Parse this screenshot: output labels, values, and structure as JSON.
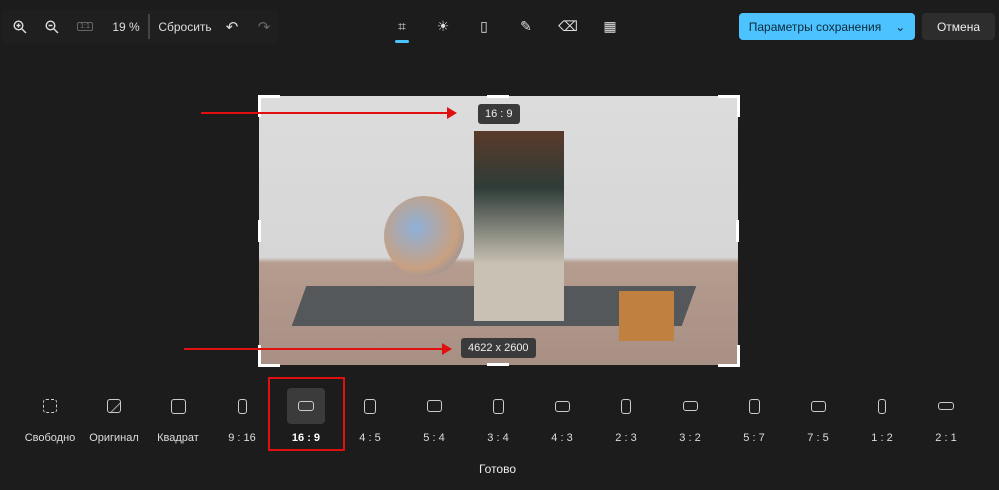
{
  "toolbar": {
    "zoom": "19 %",
    "reset": "Сбросить",
    "one_to_one": "1:1"
  },
  "tools": [
    "crop",
    "brightness",
    "marker",
    "pen",
    "eraser",
    "background-blur"
  ],
  "save_label": "Параметры сохранения",
  "cancel_label": "Отмена",
  "canvas": {
    "ratio_tag": "16 : 9",
    "size_tag": "4622 x 2600"
  },
  "ratios": [
    {
      "label": "Свободно",
      "shape": "free",
      "w": 14,
      "h": 14
    },
    {
      "label": "Оригинал",
      "shape": "image",
      "w": 14,
      "h": 14
    },
    {
      "label": "Квадрат",
      "shape": "rect",
      "w": 15,
      "h": 15
    },
    {
      "label": "9 : 16",
      "shape": "rect",
      "w": 9,
      "h": 15
    },
    {
      "label": "16 : 9",
      "shape": "rect",
      "w": 16,
      "h": 10
    },
    {
      "label": "4 : 5",
      "shape": "rect",
      "w": 12,
      "h": 15
    },
    {
      "label": "5 : 4",
      "shape": "rect",
      "w": 15,
      "h": 12
    },
    {
      "label": "3 : 4",
      "shape": "rect",
      "w": 11,
      "h": 15
    },
    {
      "label": "4 : 3",
      "shape": "rect",
      "w": 15,
      "h": 11
    },
    {
      "label": "2 : 3",
      "shape": "rect",
      "w": 10,
      "h": 15
    },
    {
      "label": "3 : 2",
      "shape": "rect",
      "w": 15,
      "h": 10
    },
    {
      "label": "5 : 7",
      "shape": "rect",
      "w": 11,
      "h": 15
    },
    {
      "label": "7 : 5",
      "shape": "rect",
      "w": 15,
      "h": 11
    },
    {
      "label": "1 : 2",
      "shape": "rect",
      "w": 8,
      "h": 15
    },
    {
      "label": "2 : 1",
      "shape": "rect",
      "w": 16,
      "h": 8
    }
  ],
  "selected_ratio": 4,
  "done_label": "Готово",
  "accent": "#4cc2ff",
  "highlight": "#e01010"
}
